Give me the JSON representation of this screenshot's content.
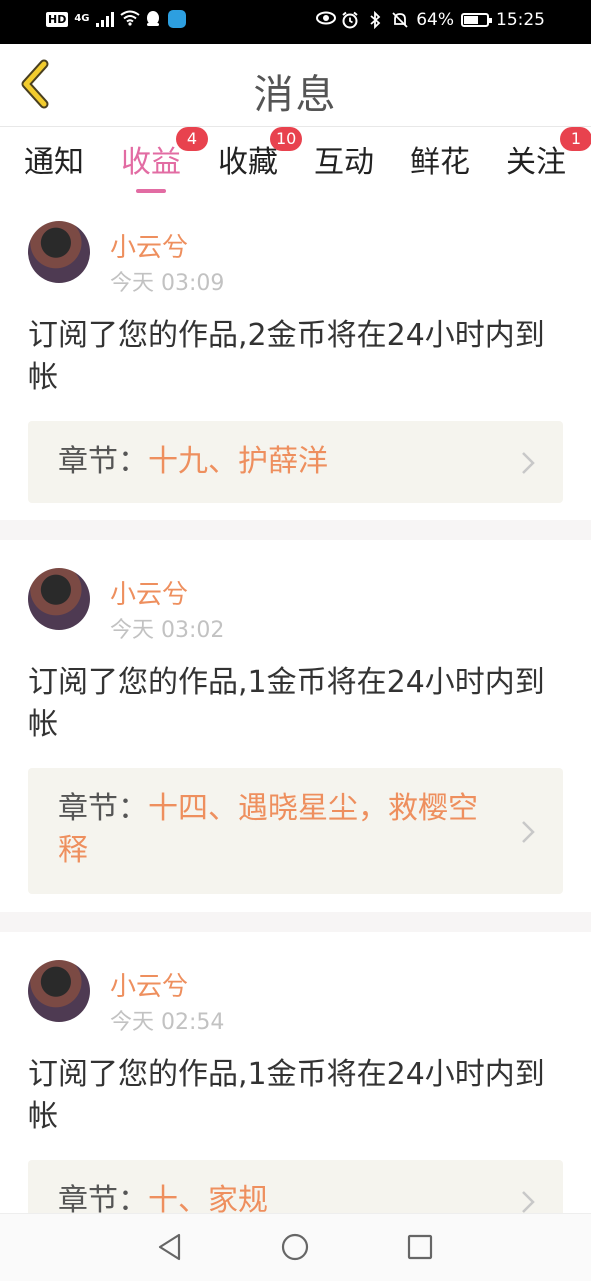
{
  "status_bar": {
    "hd": "HD",
    "network": "4G",
    "battery_text": "64%",
    "battery_level": 0.64,
    "time": "15:25",
    "icons": [
      "signal-icon",
      "wifi-icon",
      "qq-icon",
      "app-icon",
      "eye-icon",
      "alarm-icon",
      "bluetooth-icon",
      "mute-icon",
      "battery-icon"
    ]
  },
  "header": {
    "title": "消息",
    "back_icon": "chevron-left-icon"
  },
  "tabs": [
    {
      "label": "通知",
      "badge": ""
    },
    {
      "label": "收益",
      "badge": "4",
      "active": true
    },
    {
      "label": "收藏",
      "badge": "10"
    },
    {
      "label": "互动",
      "badge": ""
    },
    {
      "label": "鲜花",
      "badge": ""
    },
    {
      "label": "关注",
      "badge": "1"
    }
  ],
  "colors": {
    "accent": "#e26ca3",
    "badge": "#e8424e",
    "orange": "#ee8f5e",
    "card_bg": "#f5f4ee"
  },
  "messages": [
    {
      "user": "小云兮",
      "time": "今天 03:09",
      "text": "订阅了您的作品,2金币将在24小时内到帐",
      "chapter_prefix": "章节：",
      "chapter_title": "十九、护薛洋"
    },
    {
      "user": "小云兮",
      "time": "今天 03:02",
      "text": "订阅了您的作品,1金币将在24小时内到帐",
      "chapter_prefix": "章节：",
      "chapter_title": "十四、遇晓星尘，救樱空释"
    },
    {
      "user": "小云兮",
      "time": "今天 02:54",
      "text": "订阅了您的作品,1金币将在24小时内到帐",
      "chapter_prefix": "章节：",
      "chapter_title": "十、家规"
    }
  ],
  "navbar": {
    "icons": [
      "back-triangle-icon",
      "home-circle-icon",
      "recents-square-icon"
    ]
  }
}
